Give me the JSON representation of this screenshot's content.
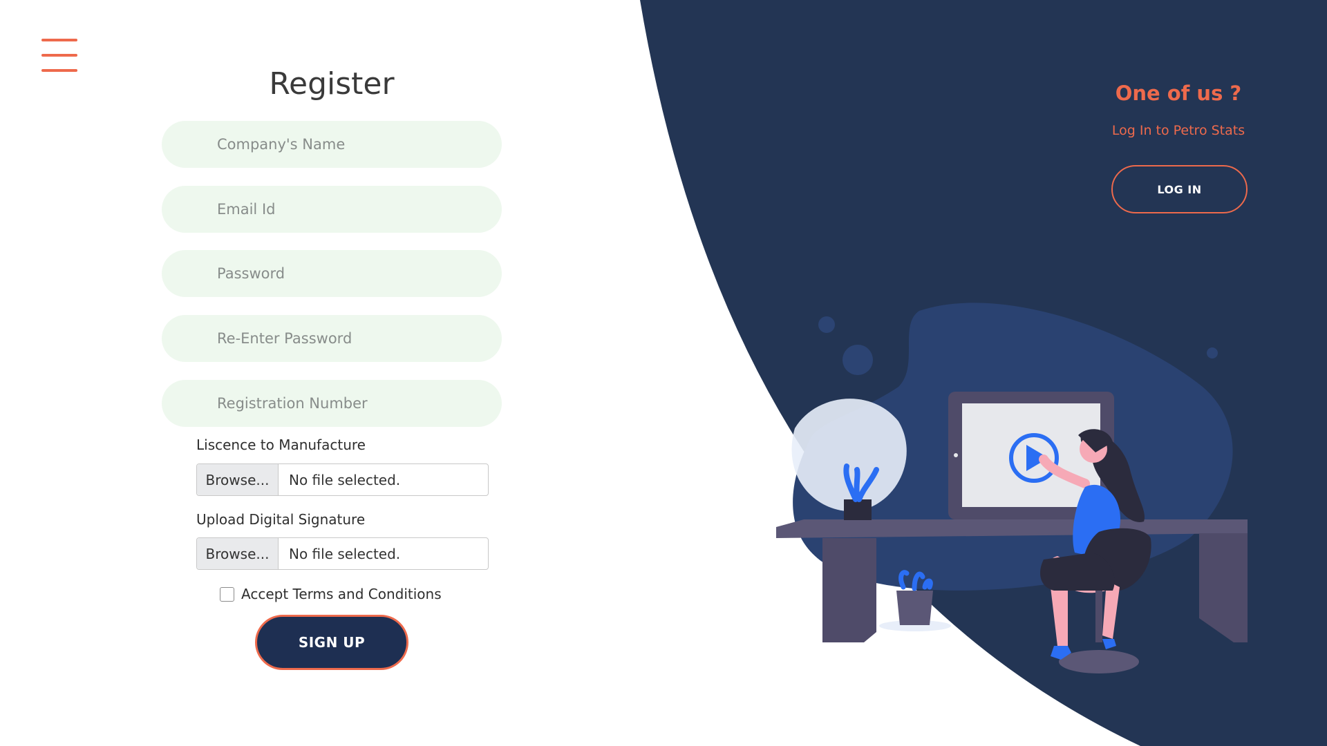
{
  "menu": {
    "icon": "hamburger-icon"
  },
  "register": {
    "title": "Register",
    "fields": {
      "company_name": {
        "placeholder": "Company's Name",
        "value": ""
      },
      "email": {
        "placeholder": "Email Id",
        "value": ""
      },
      "password": {
        "placeholder": "Password",
        "value": ""
      },
      "confirm_password": {
        "placeholder": "Re-Enter Password",
        "value": ""
      },
      "registration_number": {
        "placeholder": "Registration Number",
        "value": ""
      }
    },
    "licence_upload": {
      "label": "Liscence to Manufacture",
      "browse_label": "Browse...",
      "status": "No file selected."
    },
    "signature_upload": {
      "label": "Upload Digital Signature",
      "browse_label": "Browse...",
      "status": "No file selected."
    },
    "terms": {
      "label": "Accept Terms and Conditions",
      "checked": false
    },
    "signup_label": "SIGN UP"
  },
  "login_panel": {
    "heading": "One of us ?",
    "subtitle": "Log In to Petro Stats",
    "button_label": "LOG IN"
  },
  "colors": {
    "accent": "#ee6a4c",
    "navy": "#1e2f52",
    "field_bg": "#eef8ee",
    "panel_bg": "#233554"
  },
  "illustration": {
    "name": "woman-at-desk-watching-video-illustration"
  }
}
